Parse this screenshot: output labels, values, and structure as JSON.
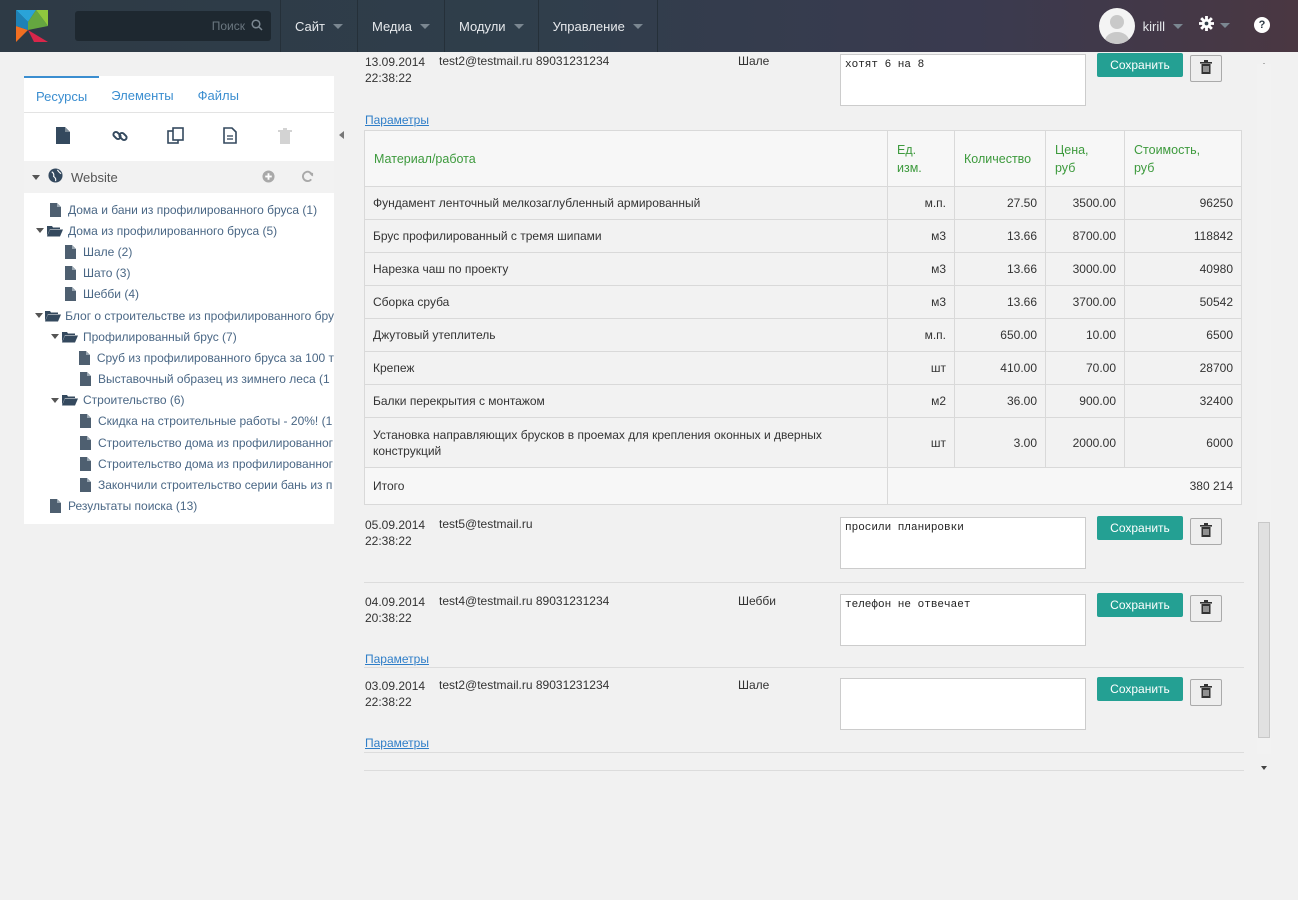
{
  "header": {
    "search_placeholder": "Поиск",
    "nav": [
      "Сайт",
      "Медиа",
      "Модули",
      "Управление"
    ],
    "username": "kirill",
    "help_label": "?"
  },
  "sidebar": {
    "tabs": [
      "Ресурсы",
      "Элементы",
      "Файлы"
    ],
    "root_label": "Website",
    "tree": [
      {
        "label": "Дома и бани из профилированного бруса (1)",
        "level": 0,
        "type": "doc"
      },
      {
        "label": "Дома из профилированного бруса (5)",
        "level": 0,
        "type": "folder"
      },
      {
        "label": "Шале (2)",
        "level": 1,
        "type": "doc"
      },
      {
        "label": "Шато (3)",
        "level": 1,
        "type": "doc"
      },
      {
        "label": "Шебби (4)",
        "level": 1,
        "type": "doc"
      },
      {
        "label": "Блог о строительстве из профилированного бру",
        "level": 0,
        "type": "folder"
      },
      {
        "label": "Профилированный брус (7)",
        "level": 1,
        "type": "folder"
      },
      {
        "label": "Сруб из профилированного бруса за 100 т",
        "level": 2,
        "type": "doc"
      },
      {
        "label": "Выставочный образец из зимнего леса (1",
        "level": 2,
        "type": "doc"
      },
      {
        "label": "Строительство (6)",
        "level": 1,
        "type": "folder"
      },
      {
        "label": "Скидка на строительные работы - 20%! (1",
        "level": 2,
        "type": "doc"
      },
      {
        "label": "Строительство дома из профилированног",
        "level": 2,
        "type": "doc"
      },
      {
        "label": "Строительство дома из профилированног",
        "level": 2,
        "type": "doc"
      },
      {
        "label": "Закончили строительство серии бань из п",
        "level": 2,
        "type": "doc"
      },
      {
        "label": "Результаты поиска (13)",
        "level": 0,
        "type": "doc"
      }
    ]
  },
  "main": {
    "save_label": "Сохранить",
    "params_label": "Параметры",
    "table": {
      "headers": [
        "Материал/работа",
        "Ед.\nизм.",
        "Количество",
        "Цена,\nруб",
        "Стоимость,\nруб"
      ],
      "rows": [
        [
          "Фундамент ленточный мелкозаглубленный армированный",
          "м.п.",
          "27.50",
          "3500.00",
          "96250"
        ],
        [
          "Брус профилированный с тремя шипами",
          "м3",
          "13.66",
          "8700.00",
          "118842"
        ],
        [
          "Нарезка чаш по проекту",
          "м3",
          "13.66",
          "3000.00",
          "40980"
        ],
        [
          "Сборка сруба",
          "м3",
          "13.66",
          "3700.00",
          "50542"
        ],
        [
          "Джутовый утеплитель",
          "м.п.",
          "650.00",
          "10.00",
          "6500"
        ],
        [
          "Крепеж",
          "шт",
          "410.00",
          "70.00",
          "28700"
        ],
        [
          "Балки перекрытия с монтажом",
          "м2",
          "36.00",
          "900.00",
          "32400"
        ],
        [
          "Установка направляющих брусков в проемах для крепления оконных и дверных конструкций",
          "шт",
          "3.00",
          "2000.00",
          "6000"
        ]
      ],
      "total_label": "Итого",
      "total_value": "380 214"
    },
    "entries": [
      {
        "date": "13.09.2014",
        "time": "22:38:22",
        "contact": "test2@testmail.ru 89031231234",
        "type": "Шале",
        "note": "хотят 6 на 8"
      },
      {
        "date": "05.09.2014",
        "time": "22:38:22",
        "contact": "test5@testmail.ru",
        "type": "",
        "note": "просили планировки"
      },
      {
        "date": "04.09.2014",
        "time": "20:38:22",
        "contact": "test4@testmail.ru 89031231234",
        "type": "Шебби",
        "note": "телефон не отвечает"
      },
      {
        "date": "03.09.2014",
        "time": "22:38:22",
        "contact": "test2@testmail.ru 89031231234",
        "type": "Шале",
        "note": ""
      }
    ]
  }
}
